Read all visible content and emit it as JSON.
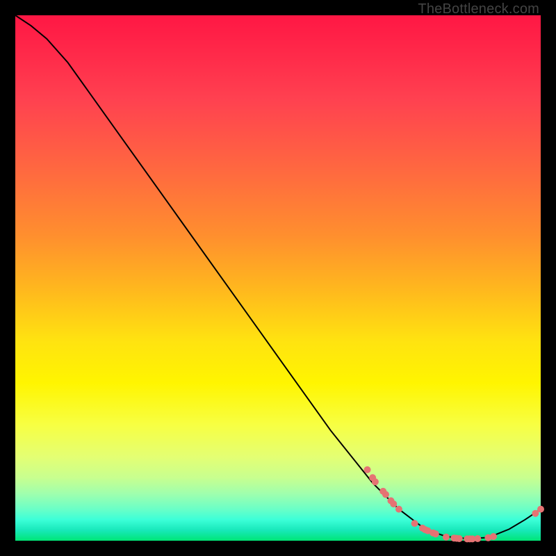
{
  "watermark": "TheBottleneck.com",
  "chart_data": {
    "type": "line",
    "title": "",
    "xlabel": "",
    "ylabel": "",
    "xlim": [
      0,
      100
    ],
    "ylim": [
      0,
      100
    ],
    "curve": [
      {
        "x": 0,
        "y": 100
      },
      {
        "x": 3,
        "y": 98
      },
      {
        "x": 6,
        "y": 95.5
      },
      {
        "x": 10,
        "y": 91
      },
      {
        "x": 20,
        "y": 77
      },
      {
        "x": 30,
        "y": 63
      },
      {
        "x": 40,
        "y": 49
      },
      {
        "x": 50,
        "y": 35
      },
      {
        "x": 60,
        "y": 21
      },
      {
        "x": 68,
        "y": 11
      },
      {
        "x": 73,
        "y": 6
      },
      {
        "x": 78,
        "y": 2.2
      },
      {
        "x": 82,
        "y": 0.8
      },
      {
        "x": 86,
        "y": 0.4
      },
      {
        "x": 90,
        "y": 0.6
      },
      {
        "x": 94,
        "y": 2.2
      },
      {
        "x": 97,
        "y": 4.0
      },
      {
        "x": 100,
        "y": 6.0
      }
    ],
    "series_points": [
      {
        "name": "markers",
        "color": "#e57373",
        "points": [
          {
            "x": 67,
            "y": 13.5
          },
          {
            "x": 68,
            "y": 12.0
          },
          {
            "x": 68.5,
            "y": 11.2
          },
          {
            "x": 70,
            "y": 9.4
          },
          {
            "x": 70.5,
            "y": 8.8
          },
          {
            "x": 71.5,
            "y": 7.6
          },
          {
            "x": 72,
            "y": 7.0
          },
          {
            "x": 73,
            "y": 6.0
          },
          {
            "x": 76,
            "y": 3.3
          },
          {
            "x": 77.5,
            "y": 2.4
          },
          {
            "x": 78,
            "y": 2.1
          },
          {
            "x": 78.5,
            "y": 1.9
          },
          {
            "x": 79.5,
            "y": 1.5
          },
          {
            "x": 80,
            "y": 1.3
          },
          {
            "x": 82,
            "y": 0.7
          },
          {
            "x": 83.5,
            "y": 0.5
          },
          {
            "x": 84,
            "y": 0.45
          },
          {
            "x": 84.5,
            "y": 0.4
          },
          {
            "x": 86,
            "y": 0.35
          },
          {
            "x": 86.5,
            "y": 0.35
          },
          {
            "x": 87,
            "y": 0.35
          },
          {
            "x": 88,
            "y": 0.4
          },
          {
            "x": 90,
            "y": 0.55
          },
          {
            "x": 91,
            "y": 0.8
          },
          {
            "x": 99,
            "y": 5.2
          },
          {
            "x": 100,
            "y": 6.0
          }
        ]
      }
    ]
  }
}
